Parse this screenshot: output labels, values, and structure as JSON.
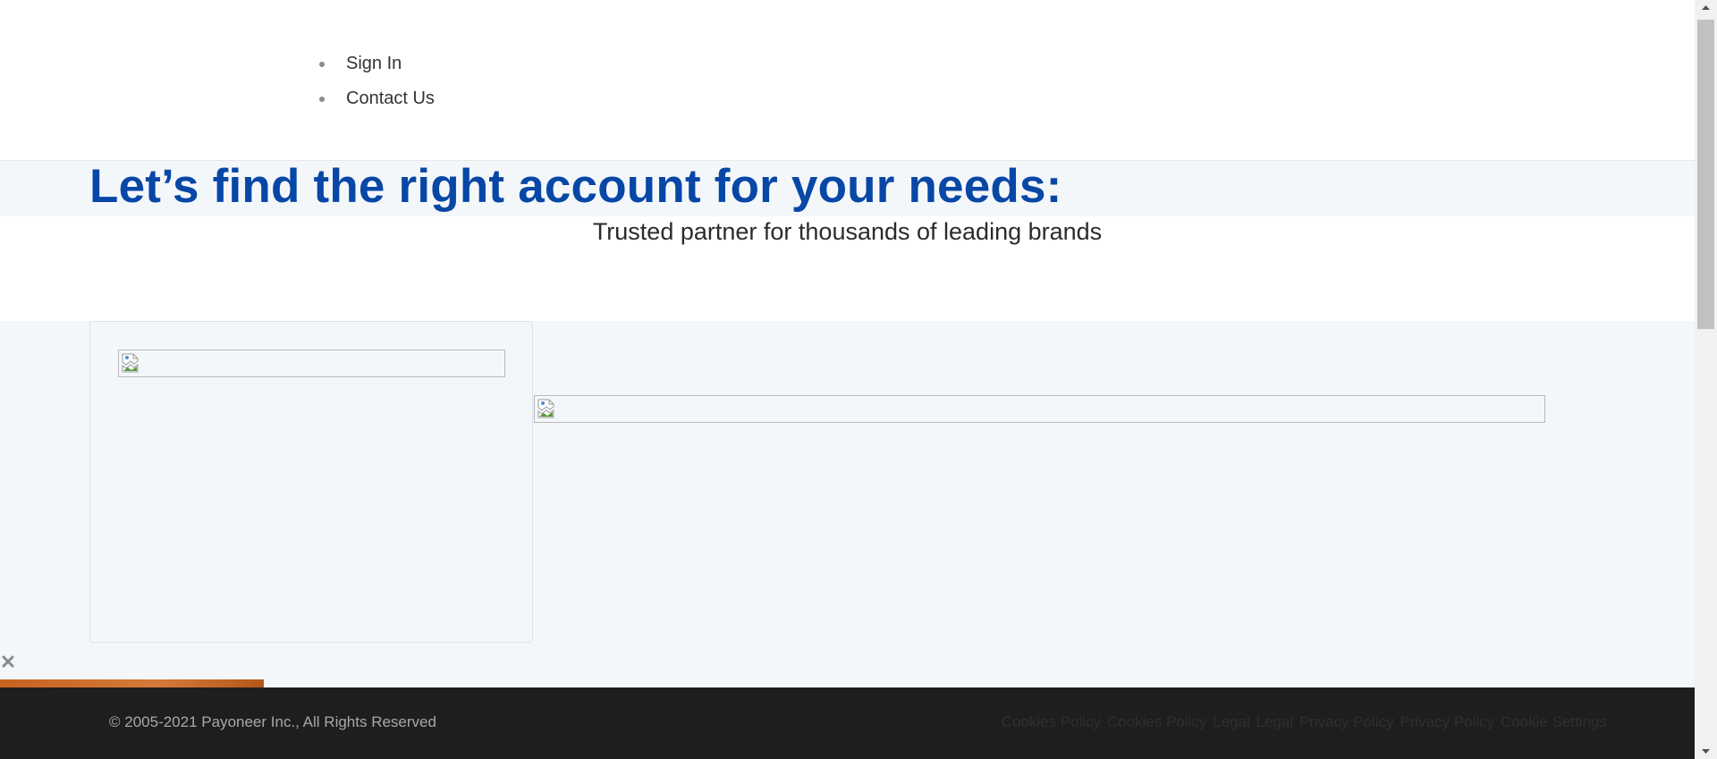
{
  "header": {
    "nav": [
      {
        "label": "Sign In"
      },
      {
        "label": "Contact Us"
      }
    ]
  },
  "hero": {
    "title": "Let’s find the right account for your needs:",
    "subtitle": "Trusted partner for thousands of leading brands"
  },
  "promo": {
    "close_icon": "close-icon",
    "accent_color": "#c8621f"
  },
  "footer": {
    "copyright": "© 2005-2021 Payoneer Inc., All Rights Reserved",
    "links": [
      "Cookies Policy",
      "Cookies Policy",
      "Legal",
      "Legal",
      "Privacy Policy",
      "Privacy Policy",
      "Cookie Settings"
    ]
  },
  "colors": {
    "brand_blue": "#0747a6",
    "section_background": "#f4f7fa",
    "footer_background": "#1e1e1e"
  }
}
